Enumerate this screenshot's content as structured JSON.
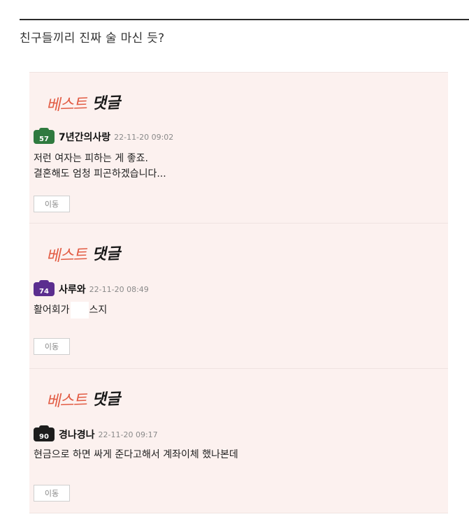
{
  "post": {
    "title": "친구들끼리 진짜 술 마신 듯?"
  },
  "best_badge": {
    "word1": "베스트",
    "word2": "댓글"
  },
  "comments": [
    {
      "level": "57",
      "level_color": "#2f7a3f",
      "nickname": "7년간의사랑",
      "date": "22-11-20 09:02",
      "lines": [
        "저런 여자는 피하는 게 좋죠.",
        "결혼해도 엄청 피곤하겠습니다..."
      ],
      "button": "이동"
    },
    {
      "level": "74",
      "level_color": "#5b2e8f",
      "nickname": "사루와",
      "date": "22-11-20 08:49",
      "text_before": "활어회가",
      "text_after": "스지",
      "button": "이동"
    },
    {
      "level": "90",
      "level_color": "#1d1d1d",
      "nickname": "경나경나",
      "date": "22-11-20 09:17",
      "lines": [
        "현금으로 하면 싸게 준다고해서 계좌이체 했나본데"
      ],
      "button": "이동"
    }
  ]
}
